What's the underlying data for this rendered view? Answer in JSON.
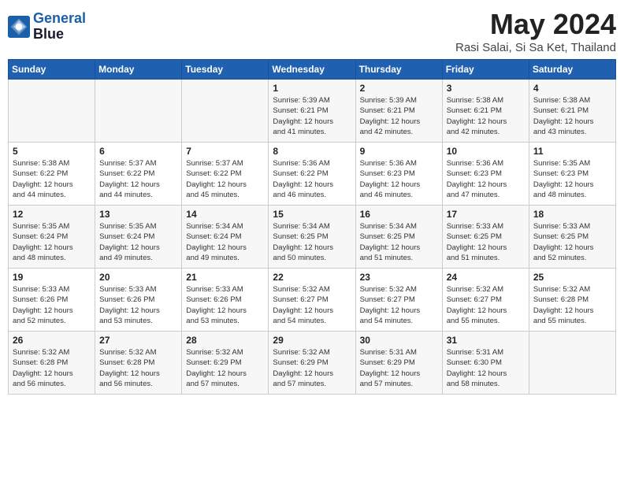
{
  "header": {
    "logo_line1": "General",
    "logo_line2": "Blue",
    "month": "May 2024",
    "location": "Rasi Salai, Si Sa Ket, Thailand"
  },
  "weekdays": [
    "Sunday",
    "Monday",
    "Tuesday",
    "Wednesday",
    "Thursday",
    "Friday",
    "Saturday"
  ],
  "weeks": [
    [
      {
        "day": "",
        "info": ""
      },
      {
        "day": "",
        "info": ""
      },
      {
        "day": "",
        "info": ""
      },
      {
        "day": "1",
        "info": "Sunrise: 5:39 AM\nSunset: 6:21 PM\nDaylight: 12 hours\nand 41 minutes."
      },
      {
        "day": "2",
        "info": "Sunrise: 5:39 AM\nSunset: 6:21 PM\nDaylight: 12 hours\nand 42 minutes."
      },
      {
        "day": "3",
        "info": "Sunrise: 5:38 AM\nSunset: 6:21 PM\nDaylight: 12 hours\nand 42 minutes."
      },
      {
        "day": "4",
        "info": "Sunrise: 5:38 AM\nSunset: 6:21 PM\nDaylight: 12 hours\nand 43 minutes."
      }
    ],
    [
      {
        "day": "5",
        "info": "Sunrise: 5:38 AM\nSunset: 6:22 PM\nDaylight: 12 hours\nand 44 minutes."
      },
      {
        "day": "6",
        "info": "Sunrise: 5:37 AM\nSunset: 6:22 PM\nDaylight: 12 hours\nand 44 minutes."
      },
      {
        "day": "7",
        "info": "Sunrise: 5:37 AM\nSunset: 6:22 PM\nDaylight: 12 hours\nand 45 minutes."
      },
      {
        "day": "8",
        "info": "Sunrise: 5:36 AM\nSunset: 6:22 PM\nDaylight: 12 hours\nand 46 minutes."
      },
      {
        "day": "9",
        "info": "Sunrise: 5:36 AM\nSunset: 6:23 PM\nDaylight: 12 hours\nand 46 minutes."
      },
      {
        "day": "10",
        "info": "Sunrise: 5:36 AM\nSunset: 6:23 PM\nDaylight: 12 hours\nand 47 minutes."
      },
      {
        "day": "11",
        "info": "Sunrise: 5:35 AM\nSunset: 6:23 PM\nDaylight: 12 hours\nand 48 minutes."
      }
    ],
    [
      {
        "day": "12",
        "info": "Sunrise: 5:35 AM\nSunset: 6:24 PM\nDaylight: 12 hours\nand 48 minutes."
      },
      {
        "day": "13",
        "info": "Sunrise: 5:35 AM\nSunset: 6:24 PM\nDaylight: 12 hours\nand 49 minutes."
      },
      {
        "day": "14",
        "info": "Sunrise: 5:34 AM\nSunset: 6:24 PM\nDaylight: 12 hours\nand 49 minutes."
      },
      {
        "day": "15",
        "info": "Sunrise: 5:34 AM\nSunset: 6:25 PM\nDaylight: 12 hours\nand 50 minutes."
      },
      {
        "day": "16",
        "info": "Sunrise: 5:34 AM\nSunset: 6:25 PM\nDaylight: 12 hours\nand 51 minutes."
      },
      {
        "day": "17",
        "info": "Sunrise: 5:33 AM\nSunset: 6:25 PM\nDaylight: 12 hours\nand 51 minutes."
      },
      {
        "day": "18",
        "info": "Sunrise: 5:33 AM\nSunset: 6:25 PM\nDaylight: 12 hours\nand 52 minutes."
      }
    ],
    [
      {
        "day": "19",
        "info": "Sunrise: 5:33 AM\nSunset: 6:26 PM\nDaylight: 12 hours\nand 52 minutes."
      },
      {
        "day": "20",
        "info": "Sunrise: 5:33 AM\nSunset: 6:26 PM\nDaylight: 12 hours\nand 53 minutes."
      },
      {
        "day": "21",
        "info": "Sunrise: 5:33 AM\nSunset: 6:26 PM\nDaylight: 12 hours\nand 53 minutes."
      },
      {
        "day": "22",
        "info": "Sunrise: 5:32 AM\nSunset: 6:27 PM\nDaylight: 12 hours\nand 54 minutes."
      },
      {
        "day": "23",
        "info": "Sunrise: 5:32 AM\nSunset: 6:27 PM\nDaylight: 12 hours\nand 54 minutes."
      },
      {
        "day": "24",
        "info": "Sunrise: 5:32 AM\nSunset: 6:27 PM\nDaylight: 12 hours\nand 55 minutes."
      },
      {
        "day": "25",
        "info": "Sunrise: 5:32 AM\nSunset: 6:28 PM\nDaylight: 12 hours\nand 55 minutes."
      }
    ],
    [
      {
        "day": "26",
        "info": "Sunrise: 5:32 AM\nSunset: 6:28 PM\nDaylight: 12 hours\nand 56 minutes."
      },
      {
        "day": "27",
        "info": "Sunrise: 5:32 AM\nSunset: 6:28 PM\nDaylight: 12 hours\nand 56 minutes."
      },
      {
        "day": "28",
        "info": "Sunrise: 5:32 AM\nSunset: 6:29 PM\nDaylight: 12 hours\nand 57 minutes."
      },
      {
        "day": "29",
        "info": "Sunrise: 5:32 AM\nSunset: 6:29 PM\nDaylight: 12 hours\nand 57 minutes."
      },
      {
        "day": "30",
        "info": "Sunrise: 5:31 AM\nSunset: 6:29 PM\nDaylight: 12 hours\nand 57 minutes."
      },
      {
        "day": "31",
        "info": "Sunrise: 5:31 AM\nSunset: 6:30 PM\nDaylight: 12 hours\nand 58 minutes."
      },
      {
        "day": "",
        "info": ""
      }
    ]
  ]
}
